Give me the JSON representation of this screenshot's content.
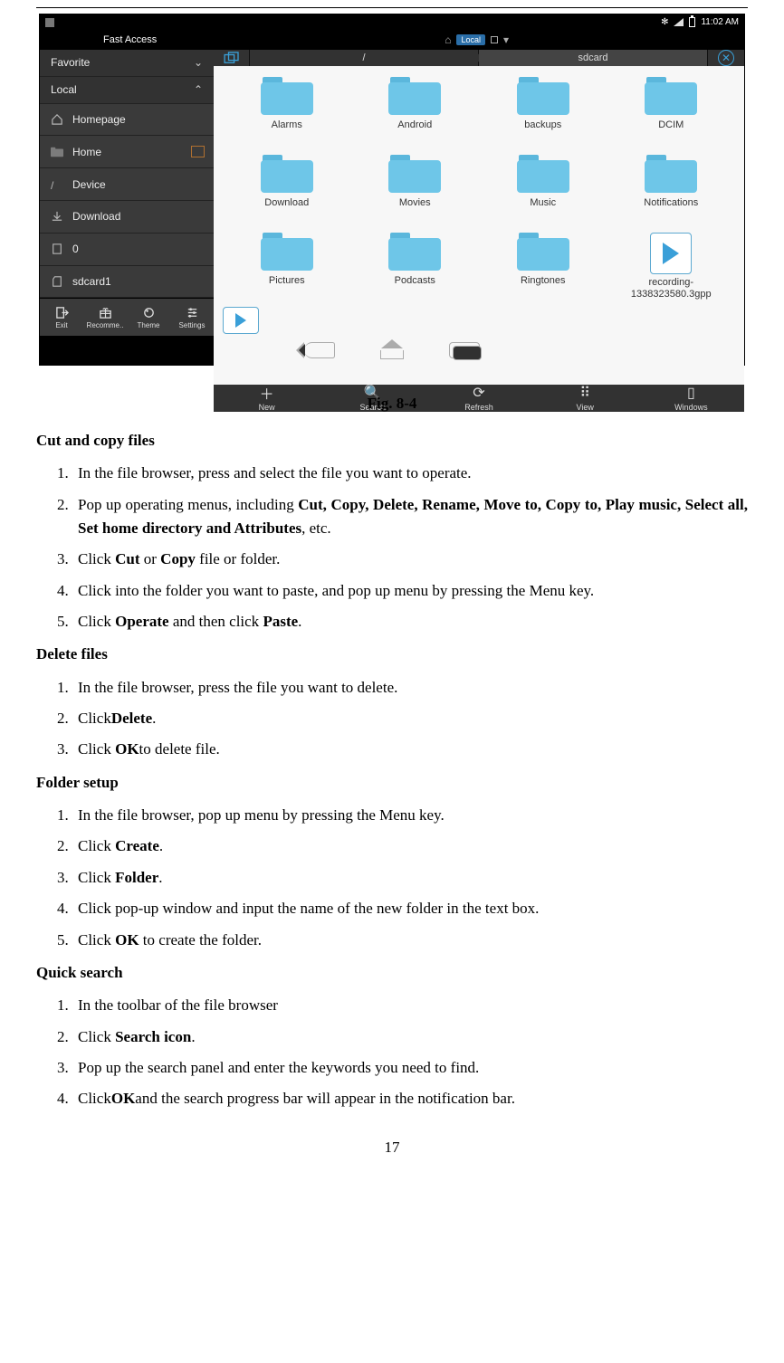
{
  "statusbar": {
    "time": "11:02 AM",
    "bt_icon": "✻"
  },
  "titlebar": {
    "fast_access": "Fast Access",
    "local_pill": "Local",
    "home_glyph": "⌂"
  },
  "sidebar": {
    "sections": {
      "favorite": "Favorite",
      "local": "Local"
    },
    "items": [
      {
        "label": "Homepage"
      },
      {
        "label": "Home"
      },
      {
        "label": "Device"
      },
      {
        "label": "Download"
      },
      {
        "label": "0"
      },
      {
        "label": "sdcard1"
      }
    ],
    "bottom": [
      {
        "label": "Exit"
      },
      {
        "label": "Recomme.."
      },
      {
        "label": "Theme"
      },
      {
        "label": "Settings"
      }
    ]
  },
  "breadcrumb": {
    "root": "/",
    "sdcard": "sdcard"
  },
  "grid": {
    "items": [
      {
        "type": "folder",
        "label": "Alarms"
      },
      {
        "type": "folder",
        "label": "Android"
      },
      {
        "type": "folder",
        "label": "backups"
      },
      {
        "type": "folder",
        "label": "DCIM"
      },
      {
        "type": "folder",
        "label": "Download"
      },
      {
        "type": "folder",
        "label": "Movies"
      },
      {
        "type": "folder",
        "label": "Music"
      },
      {
        "type": "folder",
        "label": "Notifications"
      },
      {
        "type": "folder",
        "label": "Pictures"
      },
      {
        "type": "folder",
        "label": "Podcasts"
      },
      {
        "type": "folder",
        "label": "Ringtones"
      },
      {
        "type": "file",
        "label": "recording-1338323580.3gpp"
      },
      {
        "type": "file",
        "label": ""
      }
    ]
  },
  "actions": [
    {
      "label": "New",
      "glyph": "＋"
    },
    {
      "label": "Search",
      "glyph": "🔍"
    },
    {
      "label": "Refresh",
      "glyph": "⟳"
    },
    {
      "label": "View",
      "glyph": "⠿"
    },
    {
      "label": "Windows",
      "glyph": "▯"
    }
  ],
  "figure_caption": "Fig. 8-4",
  "sections": {
    "cut_copy": {
      "head": "Cut and copy files",
      "steps": [
        "In the file browser, press and select the file you want to operate.",
        "Pop up operating menus, including <b>Cut, Copy, Delete, Rename, Move to, Copy to, Play music, Select all, Set home directory and Attributes</b>, etc.",
        "Click <b>Cut</b> or <b>Copy</b> file or folder.",
        "Click into the folder you want to paste, and pop up menu by pressing the Menu key.",
        "Click <b>Operate</b> and then click <b>Paste</b>."
      ]
    },
    "delete": {
      "head": "Delete files",
      "steps": [
        "In the file browser, press the file you want to delete.",
        "Click<b>Delete</b>.",
        "Click <b>OK</b>to delete file."
      ]
    },
    "folder_setup": {
      "head": "Folder setup",
      "steps": [
        "In the file browser, pop up menu by pressing the Menu key.",
        "Click <b>Create</b>.",
        "Click <b>Folder</b>.",
        "Click pop-up window and input the name of the new folder in the text box.",
        "Click <b>OK</b> to create the folder."
      ]
    },
    "quick_search": {
      "head": "Quick search",
      "steps": [
        "In the toolbar of the file browser",
        "Click <b>Search icon</b>.",
        "Pop up the search panel and enter the keywords you need to find.",
        "Click<b>OK</b>and the search progress bar will appear in the notification bar."
      ]
    }
  },
  "page_number": "17"
}
